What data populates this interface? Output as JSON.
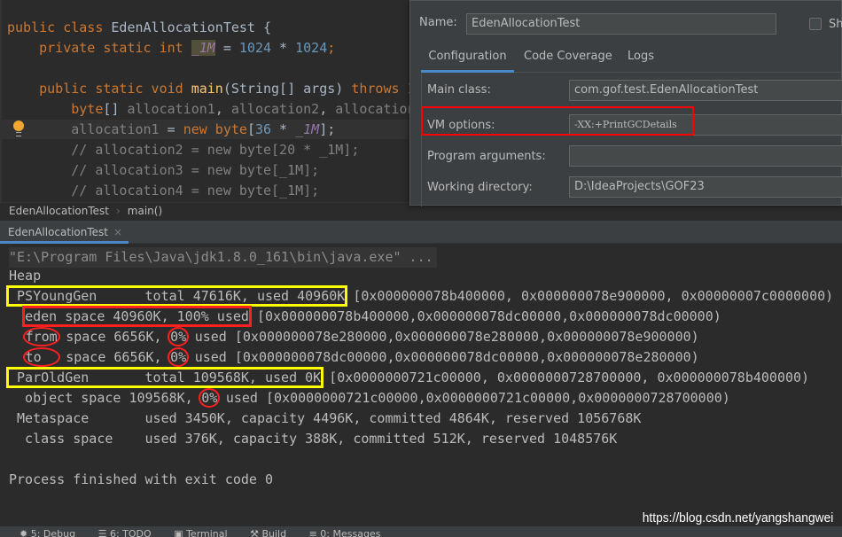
{
  "editor": {
    "lines": [
      [
        [
          "kw",
          "public class "
        ],
        [
          "id",
          "EdenAllocationTest {"
        ]
      ],
      [
        [
          "kw",
          "    private static int "
        ],
        [
          "const hl",
          "_1M"
        ],
        [
          "id",
          " = "
        ],
        [
          "num",
          "1024"
        ],
        [
          "id",
          " * "
        ],
        [
          "num",
          "1024"
        ],
        [
          "kw",
          ";"
        ]
      ],
      [],
      [
        [
          "kw",
          "    public static void "
        ],
        [
          "fn",
          "main"
        ],
        [
          "id",
          "(String[] args) "
        ],
        [
          "kw",
          "throws I"
        ]
      ],
      [
        [
          "kw",
          "        byte"
        ],
        [
          "id",
          "[] "
        ],
        [
          "gray",
          "allocation1"
        ],
        [
          "id",
          ", "
        ],
        [
          "gray",
          "allocation2"
        ],
        [
          "id",
          ", "
        ],
        [
          "gray",
          "allocation"
        ]
      ],
      [
        [
          "gray",
          "        allocation1"
        ],
        [
          "id",
          " = "
        ],
        [
          "kw",
          "new byte"
        ],
        [
          "id",
          "["
        ],
        [
          "num",
          "36"
        ],
        [
          "id",
          " * "
        ],
        [
          "const",
          "_1M"
        ],
        [
          "id",
          "];"
        ]
      ],
      [
        [
          "cm",
          "        // allocation2 = new byte[20 * _1M];"
        ]
      ],
      [
        [
          "cm",
          "        // allocation3 = new byte[_1M];"
        ]
      ],
      [
        [
          "cm",
          "        // allocation4 = new byte[_1M];"
        ]
      ]
    ]
  },
  "breadcrumb": {
    "class": "EdenAllocationTest",
    "method": "main()",
    "separator": "›"
  },
  "run_tab": {
    "label": "EdenAllocationTest",
    "close": "×"
  },
  "console": {
    "command": "\"E:\\Program Files\\Java\\jdk1.8.0_161\\bin\\java.exe\" ...",
    "lines": [
      [
        [
          "",
          "Heap"
        ]
      ],
      [
        [
          "",
          ""
        ],
        [
          "ybox",
          " PSYoungGen      total 47616K, used 40960K"
        ],
        [
          "",
          " [0x000000078b400000, 0x000000078e900000, 0x00000007c0000000)"
        ]
      ],
      [
        [
          "",
          "  "
        ],
        [
          "rbox",
          "eden space 40960K, 100% used"
        ],
        [
          "",
          " [0x000000078b400000,0x000000078dc00000,0x000000078dc00000)"
        ]
      ],
      [
        [
          "",
          "  "
        ],
        [
          "rcirc",
          "from"
        ],
        [
          "",
          " space 6656K, "
        ],
        [
          "rcirc",
          "0%"
        ],
        [
          "",
          " used [0x000000078e280000,0x000000078e280000,0x000000078e900000)"
        ]
      ],
      [
        [
          "",
          "  "
        ],
        [
          "rcirc",
          "to  "
        ],
        [
          "",
          " space 6656K, "
        ],
        [
          "rcirc",
          "0%"
        ],
        [
          "",
          " used [0x000000078dc00000,0x000000078dc00000,0x000000078e280000)"
        ]
      ],
      [
        [
          "",
          ""
        ],
        [
          "ybox",
          " ParOldGen       total 109568K, used 0K"
        ],
        [
          "",
          " [0x0000000721c00000, 0x0000000728700000, 0x000000078b400000)"
        ]
      ],
      [
        [
          "",
          "  object space 109568K, "
        ],
        [
          "rcirc",
          "0%"
        ],
        [
          "",
          " used [0x0000000721c00000,0x0000000721c00000,0x0000000728700000)"
        ]
      ],
      [
        [
          "",
          " Metaspace       used 3450K, capacity 4496K, committed 4864K, reserved 1056768K"
        ]
      ],
      [
        [
          "",
          "  class space    used 376K, capacity 388K, committed 512K, reserved 1048576K"
        ]
      ],
      [],
      [
        [
          "",
          "Process finished with exit code 0"
        ]
      ]
    ]
  },
  "dialog": {
    "name_label": "Name:",
    "name_value": "EdenAllocationTest",
    "share_label": "Sha",
    "tabs": [
      "Configuration",
      "Code Coverage",
      "Logs"
    ],
    "main_class_label": "Main class:",
    "main_class_value": "com.gof.test.EdenAllocationTest",
    "vm_options_label": "VM options:",
    "vm_options_value": "-XX:+PrintGCDetails",
    "program_args_label": "Program arguments:",
    "program_args_value": "",
    "working_dir_label": "Working directory:",
    "working_dir_value": "D:\\IdeaProjects\\GOF23"
  },
  "bottom_toolbar": [
    "5: Debug",
    "6: TODO",
    "Terminal",
    "Build",
    "0: Messages"
  ],
  "watermark": "https://blog.csdn.net/yangshangwei",
  "colors": {
    "highlight_yellow": "#ffff00",
    "highlight_red": "#ff2020",
    "accent": "#4a88c7"
  }
}
